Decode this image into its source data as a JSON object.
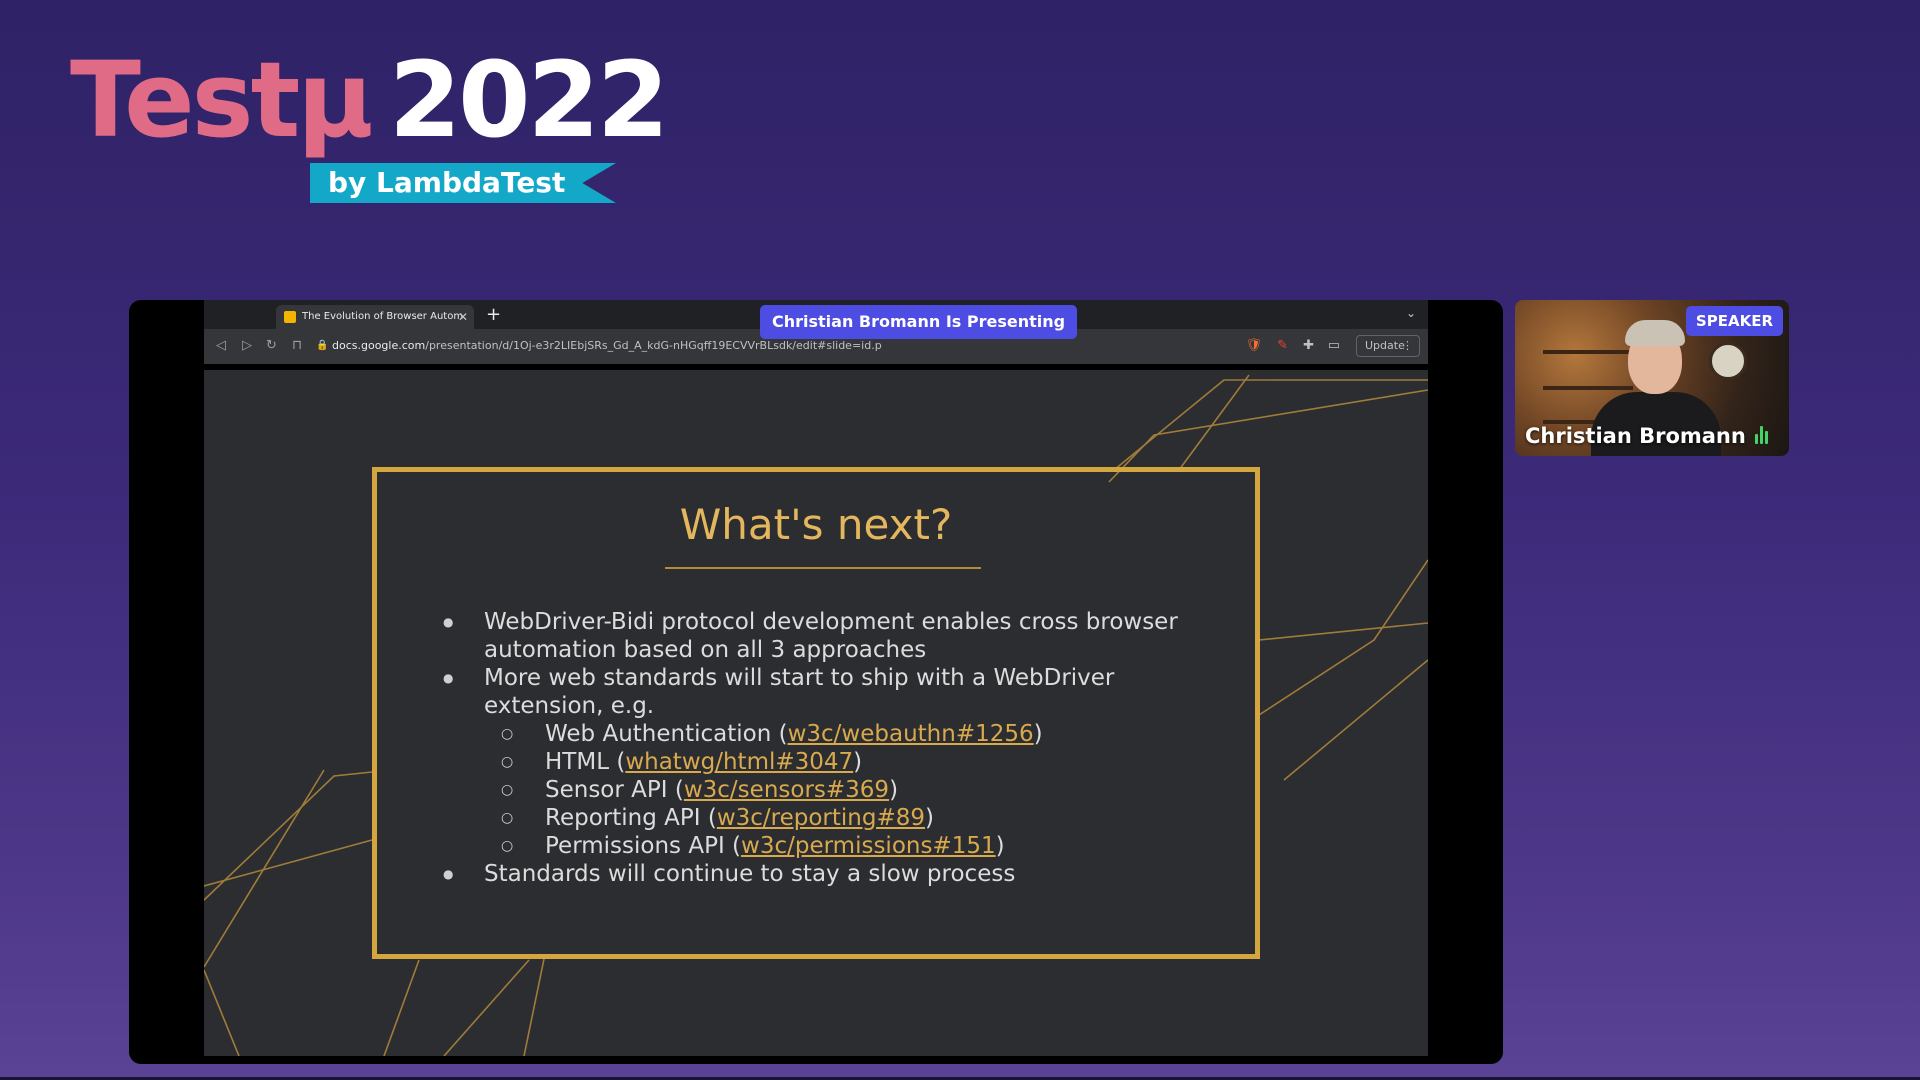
{
  "brand": {
    "word": "Testμ",
    "year": "2022",
    "ribbon": "by LambdaTest"
  },
  "browser": {
    "tab_title": "The Evolution of Browser Autom",
    "url_domain": "docs.google.com",
    "url_path": "/presentation/d/1Oj-e3r2LIEbjSRs_Gd_A_kdG-nHGqff19ECVVrBLsdk/edit#slide=id.p",
    "update_label": "Update",
    "presenting_badge": "Christian Bromann Is Presenting"
  },
  "slide": {
    "title": "What's next?",
    "bullet1": "WebDriver-Bidi protocol development enables cross browser automation based on all 3 approaches",
    "bullet2": "More web standards will start to ship with a WebDriver extension, e.g.",
    "sub_items": [
      {
        "label": "Web Authentication",
        "link": "w3c/webauthn#1256"
      },
      {
        "label": "HTML",
        "link": "whatwg/html#3047"
      },
      {
        "label": "Sensor API",
        "link": "w3c/sensors#369"
      },
      {
        "label": "Reporting API",
        "link": "w3c/reporting#89"
      },
      {
        "label": "Permissions API",
        "link": "w3c/permissions#151"
      }
    ],
    "bullet3": "Standards will continue to stay a slow process"
  },
  "speaker": {
    "tag": "SPEAKER",
    "name": "Christian Bromann"
  },
  "colors": {
    "accent_purple": "#4d4de3",
    "brand_pink": "#e06b86",
    "ribbon_cyan": "#13a8c8",
    "slide_gold": "#d4a640"
  },
  "icons": [
    "back-arrow-icon",
    "forward-arrow-icon",
    "reload-icon",
    "bookmark-icon",
    "lock-icon",
    "shield-icon",
    "extension-icon",
    "puzzle-icon",
    "sidebar-icon",
    "mic-level-icon"
  ]
}
